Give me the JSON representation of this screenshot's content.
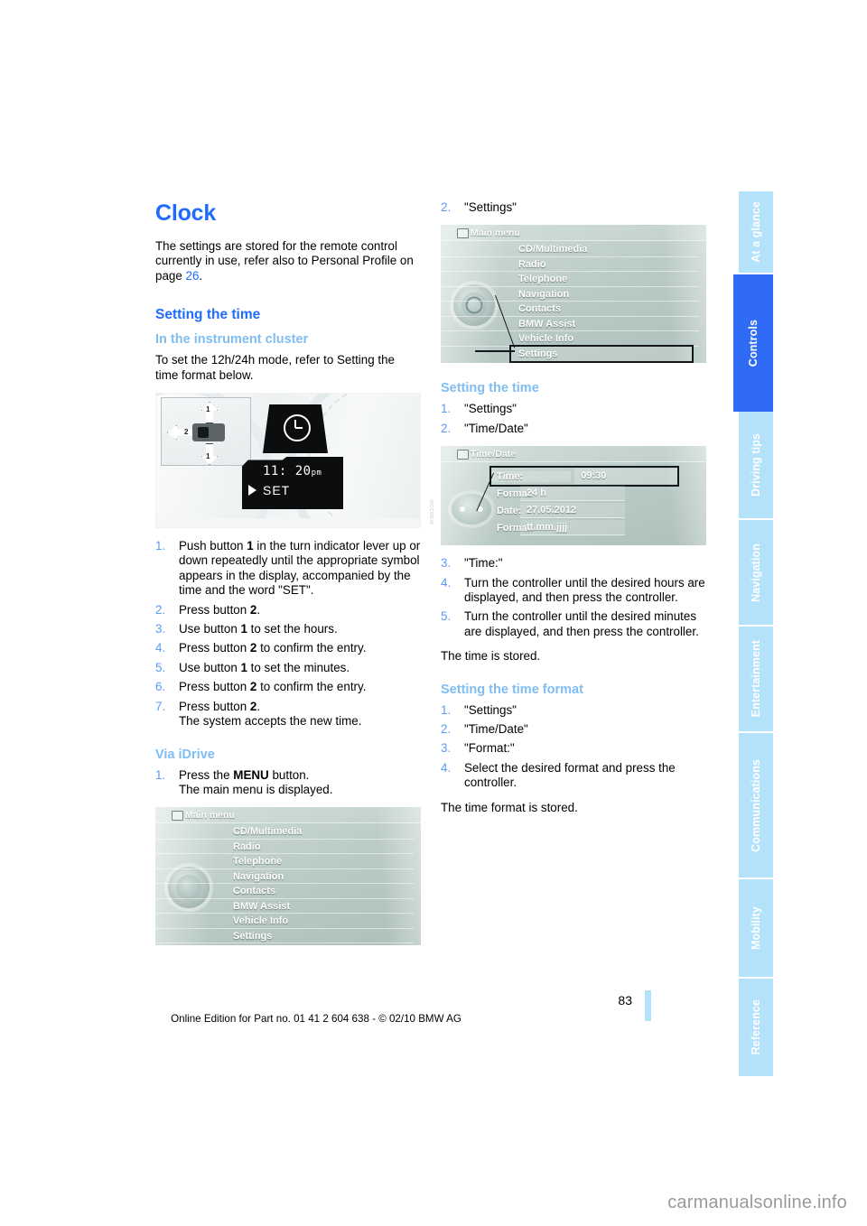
{
  "document": {
    "page_number": "83",
    "footer_line": "Online Edition for Part no. 01 41 2 604 638 - © 02/10 BMW AG",
    "watermark": "carmanualsonline.info"
  },
  "sidebar": {
    "tabs": [
      {
        "label": "At a glance",
        "active": false
      },
      {
        "label": "Controls",
        "active": true
      },
      {
        "label": "Driving tips",
        "active": false
      },
      {
        "label": "Navigation",
        "active": false
      },
      {
        "label": "Entertainment",
        "active": false
      },
      {
        "label": "Communications",
        "active": false
      },
      {
        "label": "Mobility",
        "active": false
      },
      {
        "label": "Reference",
        "active": false
      }
    ]
  },
  "left_column": {
    "title": "Clock",
    "intro_part1": "The settings are stored for the remote control currently in use, refer also to Personal Profile on page ",
    "intro_page_ref": "26",
    "intro_part2": ".",
    "heading_setting_the_time": "Setting the time",
    "subheading_instrument_cluster": "In the instrument cluster",
    "cluster_intro": "To set the 12h/24h mode, refer to Setting the time format below.",
    "cluster_figure": {
      "time_value": "11: 20",
      "time_ampm": "pm",
      "set_label": "SET",
      "callout_1": "1",
      "callout_2": "2",
      "figure_id": "WOCWEW"
    },
    "steps": [
      {
        "text_html": "Push button <b>1</b> in the turn indicator lever up or down repeatedly until the appropriate symbol appears in the display, accompanied by the time and the word \"SET\"."
      },
      {
        "text_html": "Press button <b>2</b>."
      },
      {
        "text_html": "Use button <b>1</b> to set the hours."
      },
      {
        "text_html": "Press button <b>2</b> to confirm the entry."
      },
      {
        "text_html": "Use button <b>1</b> to set the minutes."
      },
      {
        "text_html": "Press button <b>2</b> to confirm the entry."
      },
      {
        "text_html": "Press button <b>2</b>.<span class=\"sub-line\">The system accepts the new time.</span>"
      }
    ],
    "subheading_via_idrive": "Via iDrive",
    "idrive_steps": [
      {
        "text_html": "Press the <b>MENU</b> button.<span class=\"sub-line\">The main menu is displayed.</span>"
      }
    ],
    "main_menu_figure": {
      "header": "Main menu",
      "items": [
        "CD/Multimedia",
        "Radio",
        "Telephone",
        "Navigation",
        "Contacts",
        "BMW Assist",
        "Vehicle Info",
        "Settings"
      ],
      "selected": null
    }
  },
  "right_column": {
    "step2_number": "2.",
    "step2_text": "\"Settings\"",
    "main_menu_figure": {
      "header": "Main menu",
      "items": [
        "CD/Multimedia",
        "Radio",
        "Telephone",
        "Navigation",
        "Contacts",
        "BMW Assist",
        "Vehicle Info",
        "Settings"
      ],
      "selected": "Settings"
    },
    "subheading_setting_the_time": "Setting the time",
    "time_steps_a": [
      {
        "text_html": "\"Settings\""
      },
      {
        "text_html": "\"Time/Date\""
      }
    ],
    "time_date_figure": {
      "header": "Time/Date",
      "rows": [
        {
          "label": "Time:",
          "value": "09:30",
          "selected": true
        },
        {
          "label": "Format:",
          "value": "24 h",
          "selected": false
        },
        {
          "label": "Date:",
          "value": "27.05.2012",
          "selected": false
        },
        {
          "label": "Format:",
          "value": "tt.mm.jjjj",
          "selected": false
        }
      ]
    },
    "time_steps_b": [
      {
        "number": "3.",
        "text_html": "\"Time:\""
      },
      {
        "number": "4.",
        "text_html": "Turn the controller until the desired hours are displayed, and then press the controller."
      },
      {
        "number": "5.",
        "text_html": "Turn the controller until the desired minutes are displayed, and then press the controller."
      }
    ],
    "time_stored_note": "The time is stored.",
    "subheading_time_format": "Setting the time format",
    "format_steps": [
      {
        "text_html": "\"Settings\""
      },
      {
        "text_html": "\"Time/Date\""
      },
      {
        "text_html": "\"Format:\""
      },
      {
        "text_html": "Select the desired format and press the controller."
      }
    ],
    "format_stored_note": "The time format is stored."
  },
  "colors": {
    "heading_blue": "#1f6bff",
    "subheading_blue": "#7fbdf2",
    "tab_inactive": "#b5e2fb",
    "tab_active": "#2f6bf5",
    "list_number": "#5b9bf8"
  }
}
